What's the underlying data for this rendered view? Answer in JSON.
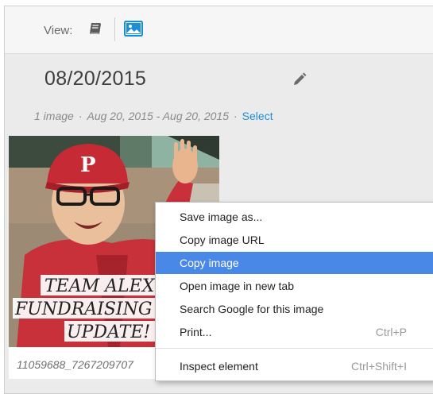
{
  "toolbar": {
    "view_label": "View:",
    "book_icon": "book-icon",
    "photo_icon": "image-icon",
    "accent": "#1a8fd6"
  },
  "album": {
    "date_title": "08/20/2015",
    "count": "1 image",
    "range": "Aug 20, 2015 - Aug 20, 2015",
    "select_label": "Select"
  },
  "photo": {
    "filename": "11059688_7267209707",
    "overlay_lines": [
      "TEAM ALEX",
      "FUNDRAISING",
      "UPDATE!"
    ]
  },
  "context_menu": {
    "highlight_color": "#4a88e8",
    "items": [
      {
        "label": "Save image as...",
        "shortcut": ""
      },
      {
        "label": "Copy image URL",
        "shortcut": ""
      },
      {
        "label": "Copy image",
        "shortcut": "",
        "highlighted": true
      },
      {
        "label": "Open image in new tab",
        "shortcut": ""
      },
      {
        "label": "Search Google for this image",
        "shortcut": ""
      },
      {
        "label": "Print...",
        "shortcut": "Ctrl+P"
      },
      {
        "label": "Inspect element",
        "shortcut": "Ctrl+Shift+I"
      }
    ]
  }
}
